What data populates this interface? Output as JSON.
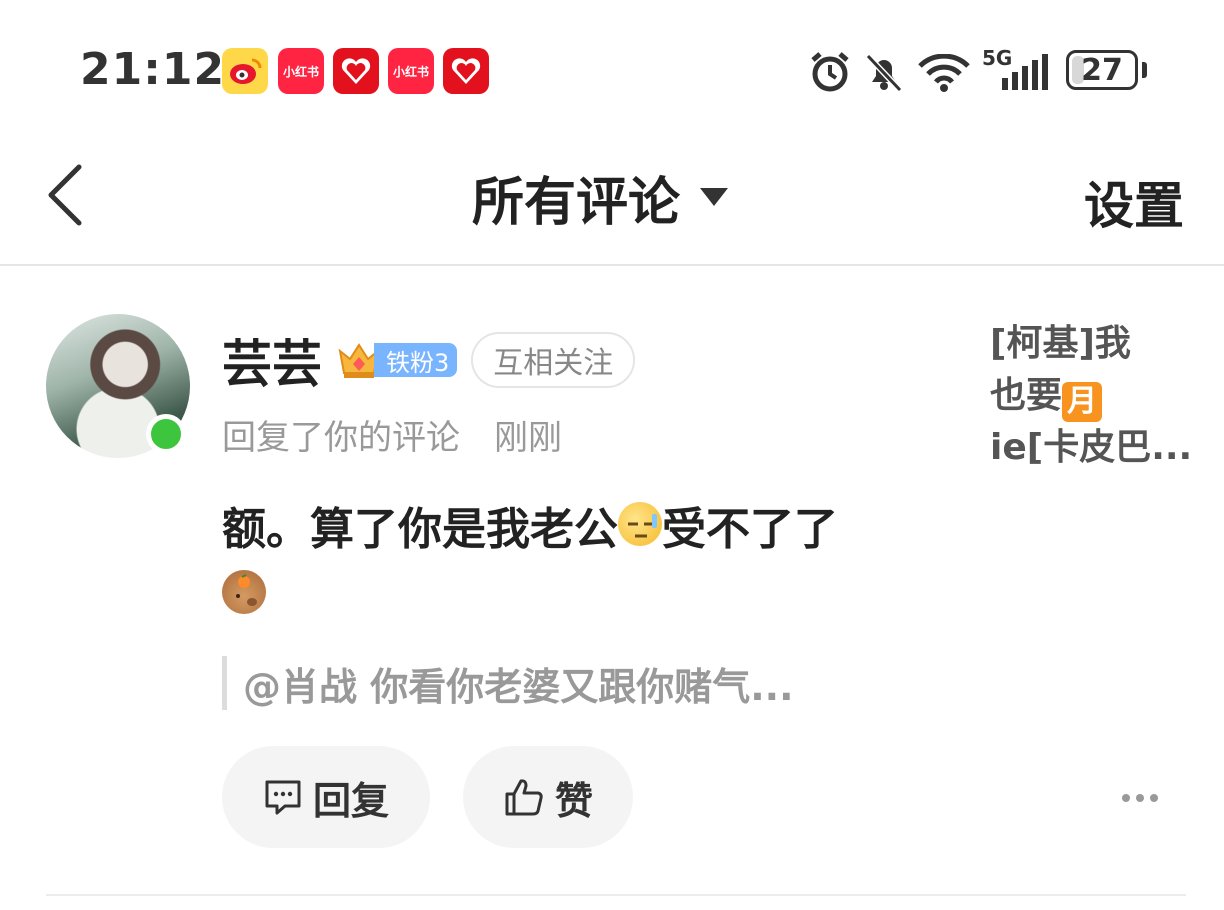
{
  "status_bar": {
    "time": "21:12",
    "apps": [
      {
        "name": "weibo",
        "label": ""
      },
      {
        "name": "xiaohongshu",
        "label": "小红书"
      },
      {
        "name": "pinduoduo",
        "label": ""
      },
      {
        "name": "xiaohongshu",
        "label": "小红书"
      },
      {
        "name": "pinduoduo",
        "label": ""
      }
    ],
    "network": "5G",
    "battery": "27",
    "battery_level": 0.27,
    "icons": [
      "alarm-icon",
      "bell-off-icon",
      "wifi-icon",
      "signal-icon",
      "battery-icon"
    ]
  },
  "header": {
    "title": "所有评论",
    "settings_label": "设置",
    "back_icon": "chevron-left-icon",
    "dropdown_icon": "caret-down-icon"
  },
  "notification": {
    "username": "芸芸",
    "fan_level": "铁粉3",
    "follow_status": "互相关注",
    "action": "回复了你的评论",
    "time": "刚刚",
    "comment_part1": "额。算了你是我老公",
    "comment_part2": "受不了了",
    "quote": "@肖战 你看你老婆又跟你赌气...",
    "reply_label": "回复",
    "like_label": "赞",
    "origin_line1": "[柯基]我",
    "origin_line2": "也要",
    "origin_emoji": "月",
    "origin_line3": "ie[卡皮巴..."
  },
  "colors": {
    "online": "#3ec53e",
    "fan_badge": "#79b4ff",
    "text_primary": "#222222",
    "text_secondary": "#999999",
    "pill_bg": "#f4f4f4"
  }
}
